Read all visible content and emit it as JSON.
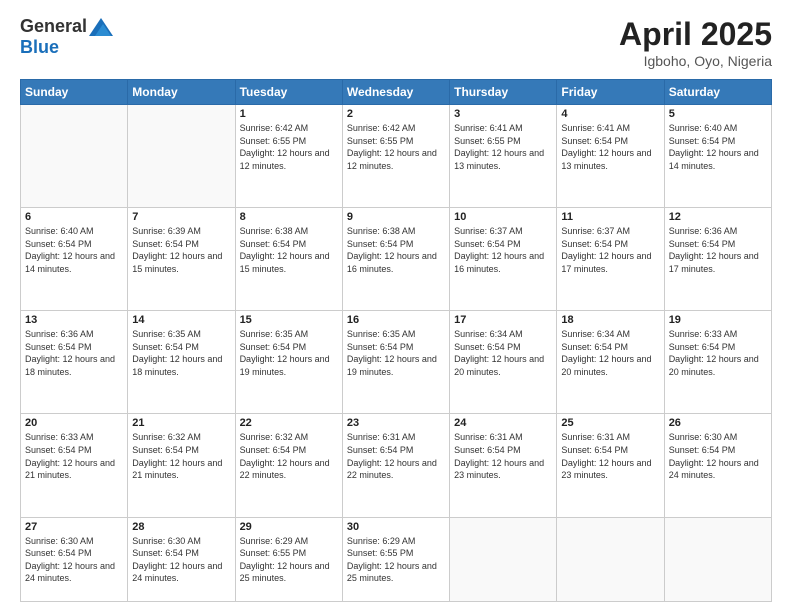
{
  "header": {
    "logo_general": "General",
    "logo_blue": "Blue",
    "title": "April 2025",
    "subtitle": "Igboho, Oyo, Nigeria"
  },
  "days_of_week": [
    "Sunday",
    "Monday",
    "Tuesday",
    "Wednesday",
    "Thursday",
    "Friday",
    "Saturday"
  ],
  "weeks": [
    [
      {
        "day": "",
        "info": ""
      },
      {
        "day": "",
        "info": ""
      },
      {
        "day": "1",
        "info": "Sunrise: 6:42 AM\nSunset: 6:55 PM\nDaylight: 12 hours and 12 minutes."
      },
      {
        "day": "2",
        "info": "Sunrise: 6:42 AM\nSunset: 6:55 PM\nDaylight: 12 hours and 12 minutes."
      },
      {
        "day": "3",
        "info": "Sunrise: 6:41 AM\nSunset: 6:55 PM\nDaylight: 12 hours and 13 minutes."
      },
      {
        "day": "4",
        "info": "Sunrise: 6:41 AM\nSunset: 6:54 PM\nDaylight: 12 hours and 13 minutes."
      },
      {
        "day": "5",
        "info": "Sunrise: 6:40 AM\nSunset: 6:54 PM\nDaylight: 12 hours and 14 minutes."
      }
    ],
    [
      {
        "day": "6",
        "info": "Sunrise: 6:40 AM\nSunset: 6:54 PM\nDaylight: 12 hours and 14 minutes."
      },
      {
        "day": "7",
        "info": "Sunrise: 6:39 AM\nSunset: 6:54 PM\nDaylight: 12 hours and 15 minutes."
      },
      {
        "day": "8",
        "info": "Sunrise: 6:38 AM\nSunset: 6:54 PM\nDaylight: 12 hours and 15 minutes."
      },
      {
        "day": "9",
        "info": "Sunrise: 6:38 AM\nSunset: 6:54 PM\nDaylight: 12 hours and 16 minutes."
      },
      {
        "day": "10",
        "info": "Sunrise: 6:37 AM\nSunset: 6:54 PM\nDaylight: 12 hours and 16 minutes."
      },
      {
        "day": "11",
        "info": "Sunrise: 6:37 AM\nSunset: 6:54 PM\nDaylight: 12 hours and 17 minutes."
      },
      {
        "day": "12",
        "info": "Sunrise: 6:36 AM\nSunset: 6:54 PM\nDaylight: 12 hours and 17 minutes."
      }
    ],
    [
      {
        "day": "13",
        "info": "Sunrise: 6:36 AM\nSunset: 6:54 PM\nDaylight: 12 hours and 18 minutes."
      },
      {
        "day": "14",
        "info": "Sunrise: 6:35 AM\nSunset: 6:54 PM\nDaylight: 12 hours and 18 minutes."
      },
      {
        "day": "15",
        "info": "Sunrise: 6:35 AM\nSunset: 6:54 PM\nDaylight: 12 hours and 19 minutes."
      },
      {
        "day": "16",
        "info": "Sunrise: 6:35 AM\nSunset: 6:54 PM\nDaylight: 12 hours and 19 minutes."
      },
      {
        "day": "17",
        "info": "Sunrise: 6:34 AM\nSunset: 6:54 PM\nDaylight: 12 hours and 20 minutes."
      },
      {
        "day": "18",
        "info": "Sunrise: 6:34 AM\nSunset: 6:54 PM\nDaylight: 12 hours and 20 minutes."
      },
      {
        "day": "19",
        "info": "Sunrise: 6:33 AM\nSunset: 6:54 PM\nDaylight: 12 hours and 20 minutes."
      }
    ],
    [
      {
        "day": "20",
        "info": "Sunrise: 6:33 AM\nSunset: 6:54 PM\nDaylight: 12 hours and 21 minutes."
      },
      {
        "day": "21",
        "info": "Sunrise: 6:32 AM\nSunset: 6:54 PM\nDaylight: 12 hours and 21 minutes."
      },
      {
        "day": "22",
        "info": "Sunrise: 6:32 AM\nSunset: 6:54 PM\nDaylight: 12 hours and 22 minutes."
      },
      {
        "day": "23",
        "info": "Sunrise: 6:31 AM\nSunset: 6:54 PM\nDaylight: 12 hours and 22 minutes."
      },
      {
        "day": "24",
        "info": "Sunrise: 6:31 AM\nSunset: 6:54 PM\nDaylight: 12 hours and 23 minutes."
      },
      {
        "day": "25",
        "info": "Sunrise: 6:31 AM\nSunset: 6:54 PM\nDaylight: 12 hours and 23 minutes."
      },
      {
        "day": "26",
        "info": "Sunrise: 6:30 AM\nSunset: 6:54 PM\nDaylight: 12 hours and 24 minutes."
      }
    ],
    [
      {
        "day": "27",
        "info": "Sunrise: 6:30 AM\nSunset: 6:54 PM\nDaylight: 12 hours and 24 minutes."
      },
      {
        "day": "28",
        "info": "Sunrise: 6:30 AM\nSunset: 6:54 PM\nDaylight: 12 hours and 24 minutes."
      },
      {
        "day": "29",
        "info": "Sunrise: 6:29 AM\nSunset: 6:55 PM\nDaylight: 12 hours and 25 minutes."
      },
      {
        "day": "30",
        "info": "Sunrise: 6:29 AM\nSunset: 6:55 PM\nDaylight: 12 hours and 25 minutes."
      },
      {
        "day": "",
        "info": ""
      },
      {
        "day": "",
        "info": ""
      },
      {
        "day": "",
        "info": ""
      }
    ]
  ]
}
